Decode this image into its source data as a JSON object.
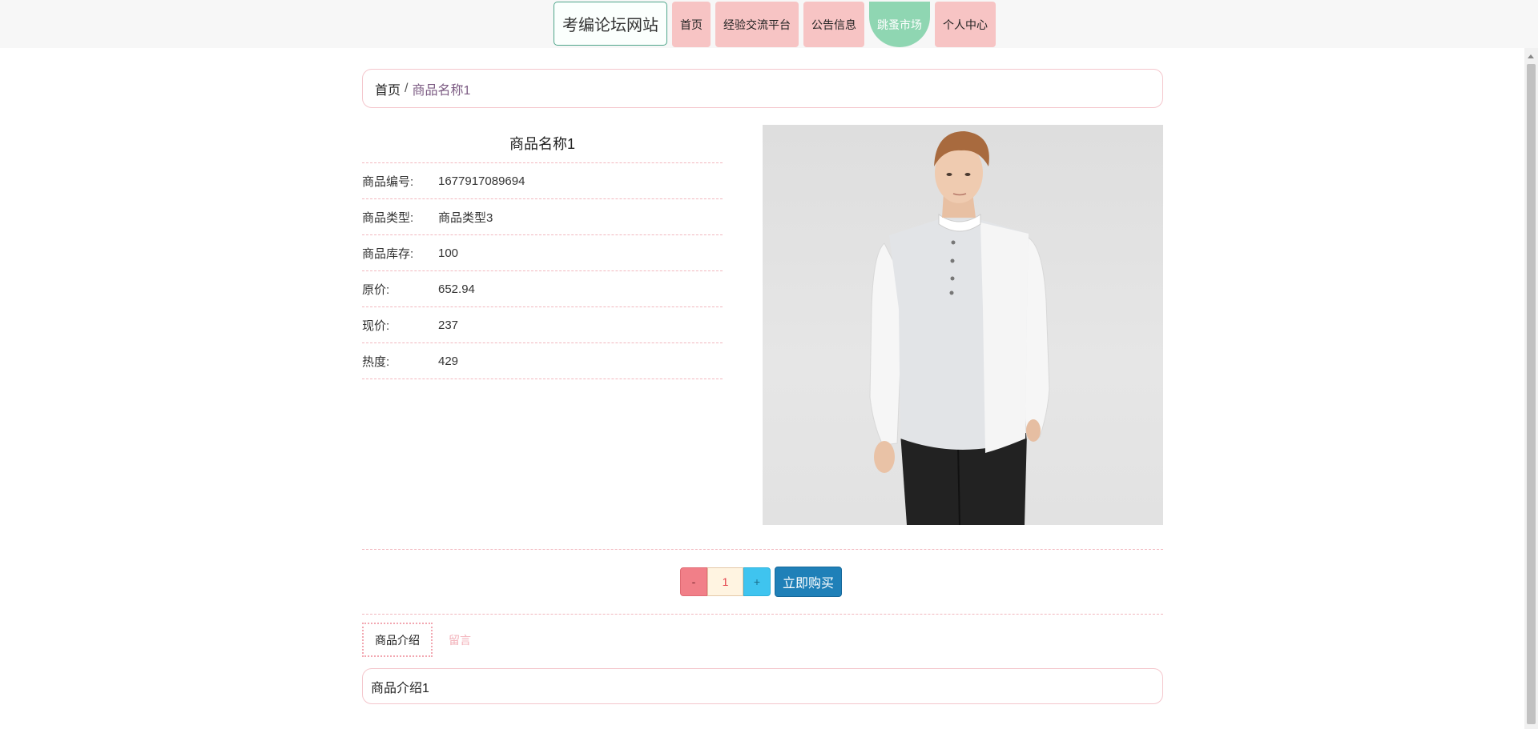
{
  "nav": {
    "brand": "考编论坛网站",
    "items": [
      {
        "label": "首页"
      },
      {
        "label": "经验交流平台"
      },
      {
        "label": "公告信息"
      },
      {
        "label": "跳蚤市场"
      },
      {
        "label": "个人中心"
      }
    ],
    "active_item": "跳蚤市场"
  },
  "breadcrumb": {
    "home": "首页",
    "separator": "/",
    "current": "商品名称1"
  },
  "product": {
    "title": "商品名称1",
    "fields": [
      {
        "label": "商品编号:",
        "value": "1677917089694"
      },
      {
        "label": "商品类型:",
        "value": "商品类型3"
      },
      {
        "label": "商品库存:",
        "value": "100"
      },
      {
        "label": "原价:",
        "value": "652.94"
      },
      {
        "label": "现价:",
        "value": "237"
      },
      {
        "label": "热度:",
        "value": "429"
      }
    ],
    "image_icon": "product-photo-icon"
  },
  "purchase": {
    "minus_label": "-",
    "quantity": "1",
    "plus_label": "+",
    "buy_label": "立即购买"
  },
  "tabs": [
    {
      "label": "商品介绍",
      "active": true
    },
    {
      "label": "留言",
      "active": false
    }
  ],
  "tab_content": "商品介绍1",
  "colors": {
    "nav_item_bg": "#f7c4c4",
    "nav_active_bg": "#8fd6b2",
    "brand_border": "#4ea58a",
    "pink_border": "#f4c6cc",
    "minus_bg": "#f17f88",
    "plus_bg": "#3fc4ef",
    "buy_bg": "#1f80b8"
  }
}
